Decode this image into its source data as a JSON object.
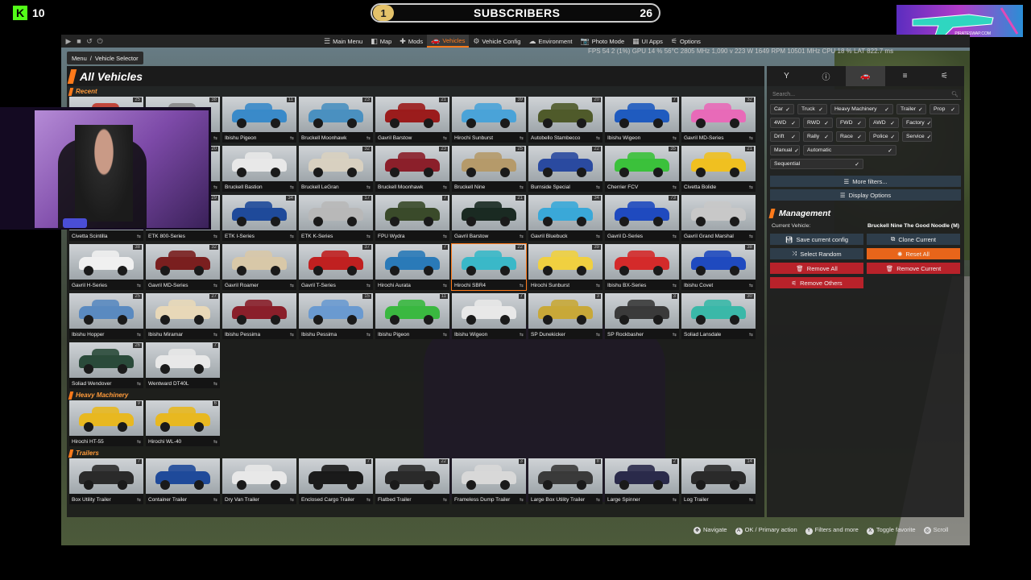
{
  "overlay": {
    "kick_logo": "K",
    "kick_count": "10",
    "subs_current": "1",
    "subs_label": "SUBSCRIBERS",
    "subs_goal": "26",
    "promo_text": "PIRATESWAP.COM"
  },
  "window_controls": [
    "▶",
    "■",
    "↺",
    "⏻"
  ],
  "nav": [
    {
      "label": "Main Menu",
      "icon": "☰",
      "active": false
    },
    {
      "label": "Map",
      "icon": "◧",
      "active": false
    },
    {
      "label": "Mods",
      "icon": "✚",
      "active": false
    },
    {
      "label": "Vehicles",
      "icon": "🚗",
      "active": true
    },
    {
      "label": "Vehicle Config",
      "icon": "⚙",
      "active": false
    },
    {
      "label": "Environment",
      "icon": "☁",
      "active": false
    },
    {
      "label": "Photo Mode",
      "icon": "📷",
      "active": false
    },
    {
      "label": "UI Apps",
      "icon": "▦",
      "active": false
    },
    {
      "label": "Options",
      "icon": "⚟",
      "active": false
    }
  ],
  "stats_text": "FPS 54   2 (1%)   GPU 14 % 56°C 2805 MHz 1,090 v 223 W 1649 RPM 10501 MHz   CPU 18 %   LAT 822.7 ms",
  "breadcrumb": {
    "root": "Menu",
    "sep": "/",
    "current": "Vehicle Selector"
  },
  "panel_title": "All Vehicles",
  "sections": [
    {
      "title": "Recent",
      "tiles": [
        {
          "name": "",
          "count": "25",
          "color": "#c0392b"
        },
        {
          "name": "",
          "count": "38",
          "color": "#888"
        },
        {
          "name": "Ibishu Pigeon",
          "count": "11",
          "color": "#3a8ac9"
        },
        {
          "name": "Bruckell Moonhawk",
          "count": "23",
          "color": "#4a90c0"
        },
        {
          "name": "Gavril Barstow",
          "count": "21",
          "color": "#9b1c1c"
        },
        {
          "name": "Hirochi Sunburst",
          "count": "39",
          "color": "#4aa3d8"
        },
        {
          "name": "Autobello Stambecco",
          "count": "20",
          "color": "#4f5a2a"
        },
        {
          "name": "Ibishu Wigeon",
          "count": "7",
          "color": "#1f5bbf"
        },
        {
          "name": "Gavril MD-Series",
          "count": "32",
          "color": "#e86ab8"
        },
        {
          "name": "",
          "count": "",
          "color": "#555"
        },
        {
          "name": "",
          "count": "20",
          "color": "#777"
        },
        {
          "name": "Bruckell Bastion",
          "count": "",
          "color": "#e8e8e8"
        },
        {
          "name": "Bruckell LeGran",
          "count": "32",
          "color": "#d8d0c0"
        },
        {
          "name": "Bruckell Moonhawk",
          "count": "23",
          "color": "#8b1f2a"
        },
        {
          "name": "Bruckell Nine",
          "count": "25",
          "color": "#b59a6a"
        },
        {
          "name": "Burnside Special",
          "count": "22",
          "color": "#2a4aa0"
        },
        {
          "name": "Cherrier FCV",
          "count": "35",
          "color": "#3bc13b"
        },
        {
          "name": "Civetta Bolide",
          "count": "21",
          "color": "#f0c020"
        },
        {
          "name": "Civetta Scintilla",
          "count": "",
          "color": "#d42020"
        },
        {
          "name": "ETK 800-Series",
          "count": "29",
          "color": "#3a4a3a"
        },
        {
          "name": "ETK I-Series",
          "count": "34",
          "color": "#1f4a9a"
        },
        {
          "name": "ETK K-Series",
          "count": "17",
          "color": "#b8b8b8"
        },
        {
          "name": "FPU Wydra",
          "count": "7",
          "color": "#3a4a2a"
        },
        {
          "name": "Gavril Barstow",
          "count": "21",
          "color": "#1a2a22"
        },
        {
          "name": "Gavril Bluebuck",
          "count": "34",
          "color": "#3aa8d8"
        },
        {
          "name": "Gavril D-Series",
          "count": "73",
          "color": "#1f4abf"
        },
        {
          "name": "Gavril Grand Marshal",
          "count": "",
          "color": "#c8c8c8"
        },
        {
          "name": "Gavril H-Series",
          "count": "38",
          "color": "#f0f0f0"
        },
        {
          "name": "Gavril MD-Series",
          "count": "32",
          "color": "#7a1f1f"
        },
        {
          "name": "Gavril Roamer",
          "count": "",
          "color": "#d8c8a8"
        },
        {
          "name": "Gavril T-Series",
          "count": "37",
          "color": "#c02020"
        },
        {
          "name": "Hirochi Aurata",
          "count": "7",
          "color": "#2a7ab8"
        },
        {
          "name": "Hirochi SBR4",
          "count": "22",
          "color": "#3ab8c8",
          "selected": true
        },
        {
          "name": "Hirochi Sunburst",
          "count": "39",
          "color": "#f0d040"
        },
        {
          "name": "Ibishu BX-Series",
          "count": "",
          "color": "#d42a2a"
        },
        {
          "name": "Ibishu Covet",
          "count": "38",
          "color": "#1f4abf"
        },
        {
          "name": "Ibishu Hopper",
          "count": "25",
          "color": "#5a8ac0"
        },
        {
          "name": "Ibishu Miramar",
          "count": "27",
          "color": "#e8d8b8"
        },
        {
          "name": "Ibishu Pessima",
          "count": "",
          "color": "#8a1f2a"
        },
        {
          "name": "Ibishu Pessima",
          "count": "15",
          "color": "#6a9ad0"
        },
        {
          "name": "Ibishu Pigeon",
          "count": "11",
          "color": "#3ab840"
        },
        {
          "name": "Ibishu Wigeon",
          "count": "7",
          "color": "#e8e8e8"
        },
        {
          "name": "SP Dunekicker",
          "count": "3",
          "color": "#c8a838"
        },
        {
          "name": "SP Rockbasher",
          "count": "3",
          "color": "#3a3a3a"
        },
        {
          "name": "Soliad Lansdale",
          "count": "30",
          "color": "#3ab8a8"
        },
        {
          "name": "Soliad Wendover",
          "count": "26",
          "color": "#2a4a3a"
        },
        {
          "name": "Wentward DT40L",
          "count": "7",
          "color": "#e8e8e8"
        }
      ]
    },
    {
      "title": "Heavy Machinery",
      "tiles": [
        {
          "name": "Hirochi HT-55",
          "count": "9",
          "color": "#e8b820"
        },
        {
          "name": "Hirochi WL-40",
          "count": "6",
          "color": "#e8b820"
        }
      ]
    },
    {
      "title": "Trailers",
      "tiles": [
        {
          "name": "Box Utility Trailer",
          "count": "7",
          "color": "#2a2a2a"
        },
        {
          "name": "Container Trailer",
          "count": "",
          "color": "#1f4a9a"
        },
        {
          "name": "Dry Van Trailer",
          "count": "",
          "color": "#e8e8e8"
        },
        {
          "name": "Enclosed Cargo Trailer",
          "count": "7",
          "color": "#1a1a1a"
        },
        {
          "name": "Flatbed Trailer",
          "count": "22",
          "color": "#2a2a2a"
        },
        {
          "name": "Frameless Dump Trailer",
          "count": "3",
          "color": "#d8d8d8"
        },
        {
          "name": "Large Box Utility Trailer",
          "count": "8",
          "color": "#3a3a3a"
        },
        {
          "name": "Large Spinner",
          "count": "2",
          "color": "#2a2a4a"
        },
        {
          "name": "Log Trailer",
          "count": "14",
          "color": "#2a2a2a"
        }
      ]
    }
  ],
  "right_tabs": [
    "Y",
    "ⓘ",
    "🚗",
    "≡",
    "⚟"
  ],
  "search_placeholder": "Search...",
  "filters": [
    {
      "label": "Car",
      "w": 1
    },
    {
      "label": "Truck",
      "w": 1
    },
    {
      "label": "Heavy Machinery",
      "w": 2
    },
    {
      "label": "Trailer",
      "w": 1
    },
    {
      "label": "Prop",
      "w": 1
    },
    {
      "label": "4WD",
      "w": 1
    },
    {
      "label": "RWD",
      "w": 1
    },
    {
      "label": "FWD",
      "w": 1
    },
    {
      "label": "AWD",
      "w": 1
    },
    {
      "label": "Factory",
      "w": 1
    },
    {
      "label": "Drift",
      "w": 1
    },
    {
      "label": "Rally",
      "w": 1
    },
    {
      "label": "Race",
      "w": 1
    },
    {
      "label": "Police",
      "w": 1
    },
    {
      "label": "Service",
      "w": 1
    },
    {
      "label": "Manual",
      "w": 1
    },
    {
      "label": "Automatic",
      "w": 3
    },
    {
      "label": "Sequential",
      "w": 3
    }
  ],
  "more_filters": "More filters...",
  "display_options": "Display Options",
  "management_title": "Management",
  "current_vehicle_label": "Current Vehicle:",
  "current_vehicle_value": "Bruckell Nine The Good Noodle (M)",
  "buttons": {
    "save_config": "Save current config",
    "clone_current": "Clone Current",
    "select_random": "Select Random",
    "reset_all": "Reset All",
    "remove_all": "Remove All",
    "remove_current": "Remove Current",
    "remove_others": "Remove Others"
  },
  "hints": [
    {
      "key": "✥",
      "label": "Navigate"
    },
    {
      "key": "A",
      "label": "OK / Primary action"
    },
    {
      "key": "Y",
      "label": "Filters and more"
    },
    {
      "key": "X",
      "label": "Toggle favorite"
    },
    {
      "key": "◎",
      "label": "Scroll"
    }
  ]
}
